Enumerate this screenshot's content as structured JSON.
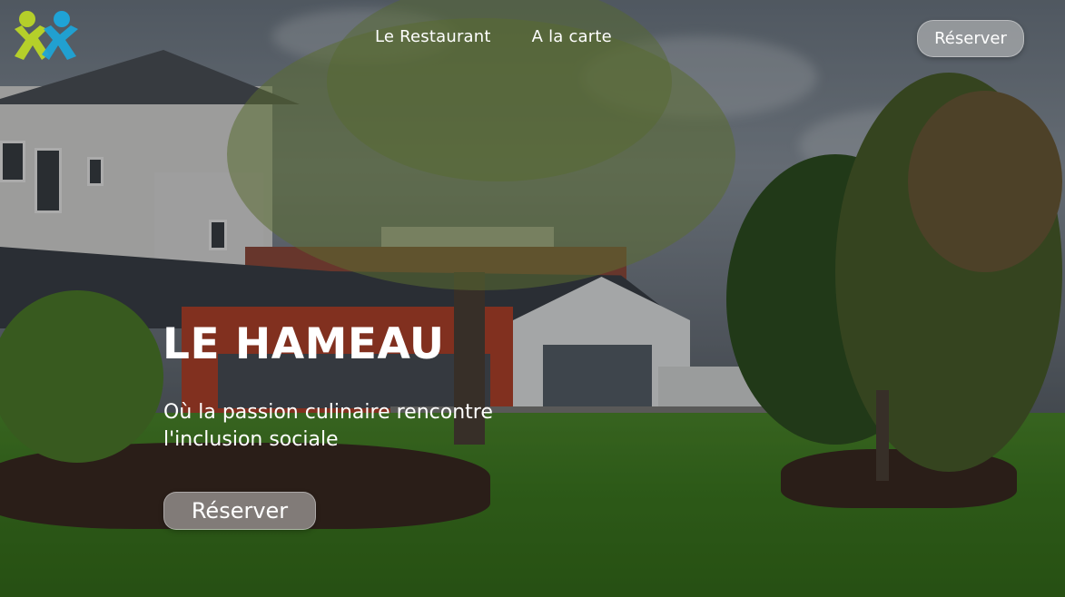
{
  "brand": {
    "logo_colors": {
      "left_figure": "#b5cf2a",
      "right_figure": "#1fa3d6"
    }
  },
  "nav": {
    "items": [
      {
        "label": "Le Restaurant"
      },
      {
        "label": "A la carte"
      }
    ]
  },
  "header": {
    "cta_label": "Réserver"
  },
  "hero": {
    "title": "LE HAMEAU",
    "subtitle_line1": "Où la passion culinaire rencontre",
    "subtitle_line2": "l'inclusion sociale",
    "cta_label": "Réserver"
  },
  "colors": {
    "text": "#ffffff",
    "button_bg": "rgba(200,200,200,0.55)"
  }
}
